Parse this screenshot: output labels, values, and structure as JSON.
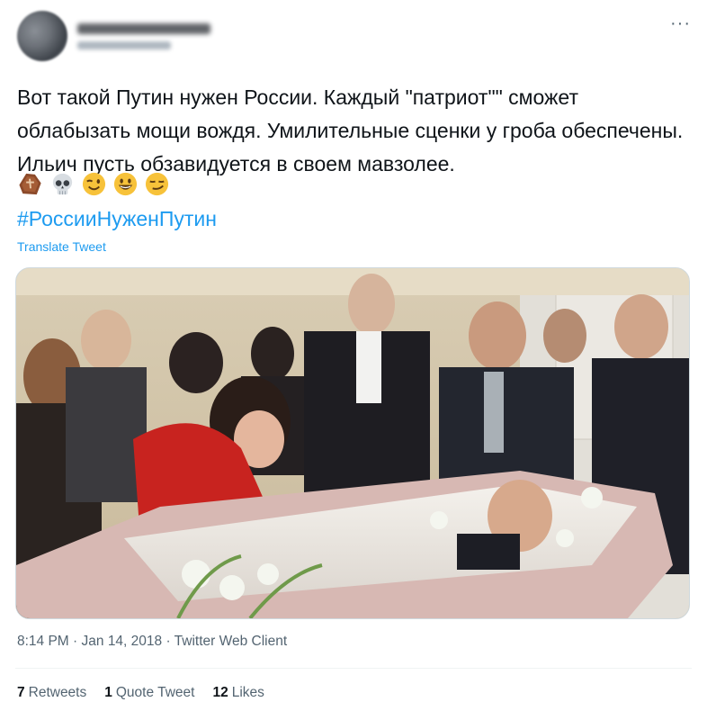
{
  "tweet": {
    "text": "Вот такой Путин нужен России. Каждый \"патриот\"\" сможет облабызать мощи вождя. Умилительные сценки у гроба обеспечены. Ильич пусть обзавидуется в своем мавзолее.",
    "emojis": [
      "coffin-icon",
      "skull-icon",
      "winking-face-icon",
      "grinning-face-icon",
      "smirking-face-icon"
    ],
    "hashtag": "#РоссииНуженПутин",
    "translate_label": "Translate Tweet",
    "more_label": "···"
  },
  "meta": {
    "time": "8:14 PM",
    "sep1": " · ",
    "date": "Jan 14, 2018",
    "sep2": " · ",
    "client": "Twitter Web Client"
  },
  "stats": {
    "retweets_count": "7",
    "retweets_label": "Retweets",
    "quote_count": "1",
    "quote_label": "Quote Tweet",
    "likes_count": "12",
    "likes_label": "Likes"
  },
  "colors": {
    "link": "#1d9bf0",
    "secondary": "#536471",
    "text": "#0f1419"
  }
}
